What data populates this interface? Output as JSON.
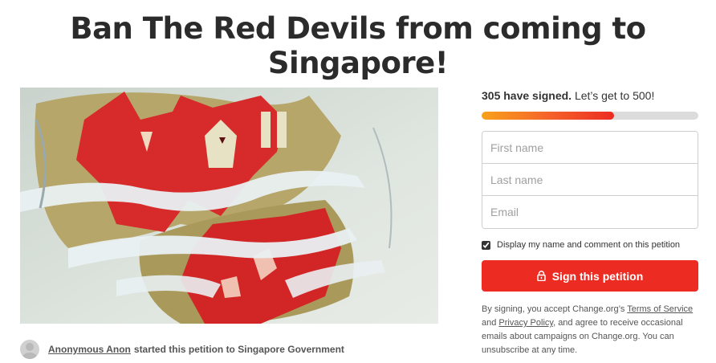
{
  "petition": {
    "title": "Ban The Red Devils from coming to Singapore!",
    "image_alt": "Drawing of a red devil emblem tearing through paper"
  },
  "starter": {
    "name": "Anonymous Anon",
    "rest_text": "started this petition to Singapore Government"
  },
  "progress": {
    "signed_text": "305 have signed.",
    "goal_text": "Let’s get to 500!",
    "signed": 305,
    "goal": 500,
    "colors": {
      "start": "#f9a11b",
      "end": "#ec2c22",
      "track": "#dcdcdc"
    }
  },
  "form": {
    "first_name_placeholder": "First name",
    "last_name_placeholder": "Last name",
    "email_placeholder": "Email",
    "display_checkbox_label": "Display my name and comment on this petition",
    "display_checked": true,
    "sign_button_label": "Sign this petition",
    "sign_button_icon": "lock-icon",
    "accent_color": "#ec2c22"
  },
  "legal": {
    "prefix": "By signing, you accept Change.org’s",
    "terms_link": "Terms of Service",
    "and": "and",
    "privacy_link": "Privacy Policy",
    "suffix": ", and agree to receive occasional emails about campaigns on Change.org. You can unsubscribe at any time."
  }
}
